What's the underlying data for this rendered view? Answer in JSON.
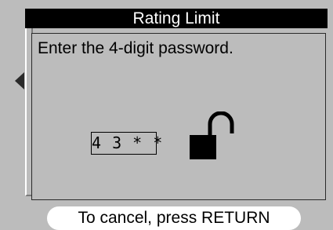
{
  "dialog": {
    "title": "Rating Limit",
    "prompt": "Enter the 4-digit password.",
    "password_display": "4 3 * *",
    "lock_state": "unlocked",
    "lock_icon": "unlocked-padlock-icon"
  },
  "footer": {
    "cancel_hint": "To cancel, press RETURN"
  },
  "colors": {
    "background": "#bcbcbc",
    "title_bar": "#000000",
    "title_text": "#ffffff",
    "pill": "#ffffff"
  }
}
